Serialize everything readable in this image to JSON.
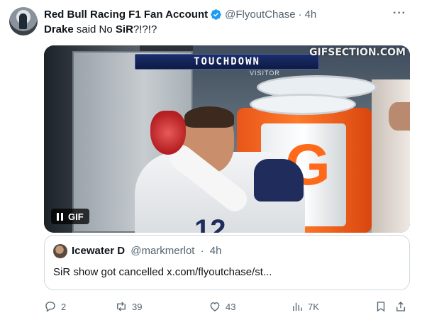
{
  "author": {
    "display_name": "Red Bull Racing F1 Fan Account",
    "handle": "@FlyoutChase",
    "time": "4h",
    "verified": true
  },
  "tweet": {
    "text_part1": "Drake",
    "text_part2": " said No ",
    "text_part3": "SiR",
    "text_part4": "?!?!?"
  },
  "media": {
    "type": "gif",
    "badge_label": "GIF",
    "scorebug_text": "TOUCHDOWN",
    "visitor_label": "VISITOR",
    "watermark": "GIFSECTION.COM",
    "jersey_number": "12"
  },
  "quoted_tweet": {
    "display_name": "Icewater D",
    "handle": "@markmerlot",
    "time": "4h",
    "text": "SiR show got cancelled x.com/flyoutchase/st..."
  },
  "actions": {
    "replies": "2",
    "reposts": "39",
    "likes": "43",
    "views": "7K"
  },
  "colors": {
    "text_primary": "#0f1419",
    "text_secondary": "#536471",
    "verified_blue": "#1d9bf0",
    "border": "#cfd9de"
  }
}
